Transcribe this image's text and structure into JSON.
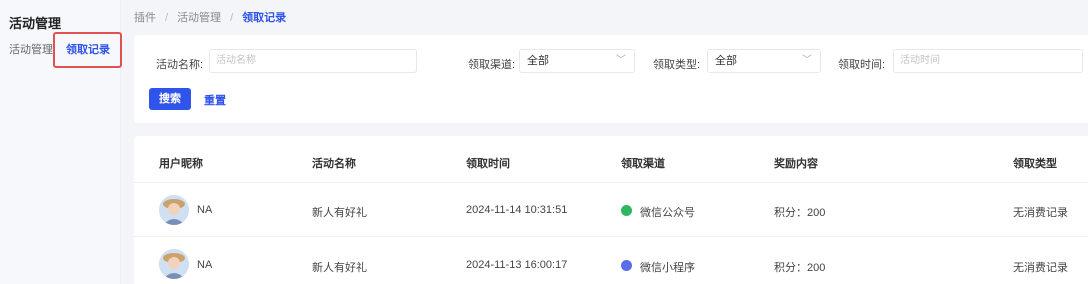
{
  "sidebar": {
    "title": "活动管理",
    "items": [
      {
        "label": "活动管理"
      },
      {
        "label": "领取记录"
      }
    ]
  },
  "breadcrumb": [
    "插件",
    "活动管理",
    "领取记录"
  ],
  "filters": {
    "activity_name": {
      "label": "活动名称:",
      "placeholder": "活动名称"
    },
    "channel": {
      "label": "领取渠道:",
      "value": "全部"
    },
    "type": {
      "label": "领取类型:",
      "value": "全部"
    },
    "time": {
      "label": "领取时间:",
      "placeholder": "活动时间"
    },
    "search_label": "搜索",
    "reset_label": "重置"
  },
  "table": {
    "columns": [
      "用户昵称",
      "活动名称",
      "领取时间",
      "领取渠道",
      "奖励内容",
      "领取类型"
    ],
    "rows": [
      {
        "nickname": "NA",
        "activity": "新人有好礼",
        "time": "2024-11-14 10:31:51",
        "channel": "微信公众号",
        "channel_color": "#2eb85c",
        "reward": "积分：200",
        "type": "无消费记录"
      },
      {
        "nickname": "NA",
        "activity": "新人有好礼",
        "time": "2024-11-13 16:00:17",
        "channel": "微信小程序",
        "channel_color": "#5b6ee8",
        "reward": "积分：200",
        "type": "无消费记录"
      }
    ]
  },
  "colors": {
    "accent": "#2f54eb",
    "highlight": "#e05252"
  }
}
